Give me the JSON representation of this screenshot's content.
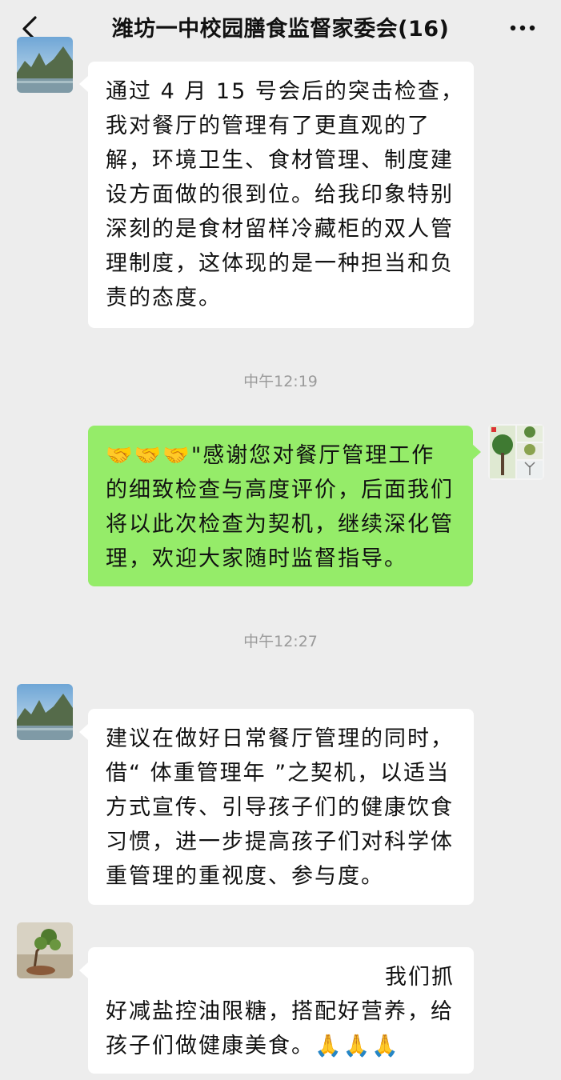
{
  "header": {
    "title": "潍坊一中校园膳食监督家委会(16)",
    "back_icon": "chevron-left-icon",
    "more_icon": "more-dots-icon"
  },
  "messages": [
    {
      "side": "left",
      "avatar": "landscape-mountain-avatar",
      "lines": [
        "通过 4 月 15 号会后的突击检查，",
        "我对餐厅的管理有了更直观的了",
        "解，环境卫生、食材管理、制度建",
        "设方面做的很到位。给我印象特别",
        "深刻的是食材留样冷藏柜的双人管",
        "理制度，这体现的是一种担当和负",
        "责的态度。"
      ]
    },
    {
      "time": "中午12:19"
    },
    {
      "side": "right",
      "avatar": "trees-collage-avatar",
      "lines": [
        "🤝🤝🤝\"感谢您对餐厅管理工作",
        "的细致检查与高度评价，后面我们",
        "将以此次检查为契机，继续深化管",
        "理，欢迎大家随时监督指导。"
      ]
    },
    {
      "time": "中午12:27"
    },
    {
      "side": "left",
      "avatar": "landscape-mountain-avatar",
      "lines": [
        "建议在做好日常餐厅管理的同时，",
        "借“ 体重管理年 ”之契机，以适当",
        "方式宣传、引导孩子们的健康饮食",
        "习惯，进一步提高孩子们对科学体",
        "重管理的重视度、参与度。"
      ]
    },
    {
      "side": "left",
      "avatar": "bonsai-plant-avatar",
      "lines": [
        "我们抓",
        "好减盐控油限糖，搭配好营养，给",
        "孩子们做健康美食。🙏🙏🙏"
      ]
    }
  ],
  "colors": {
    "background": "#ededed",
    "bubble_self": "#95ec69",
    "bubble_other": "#ffffff",
    "timestamp": "#9a9a9a"
  }
}
